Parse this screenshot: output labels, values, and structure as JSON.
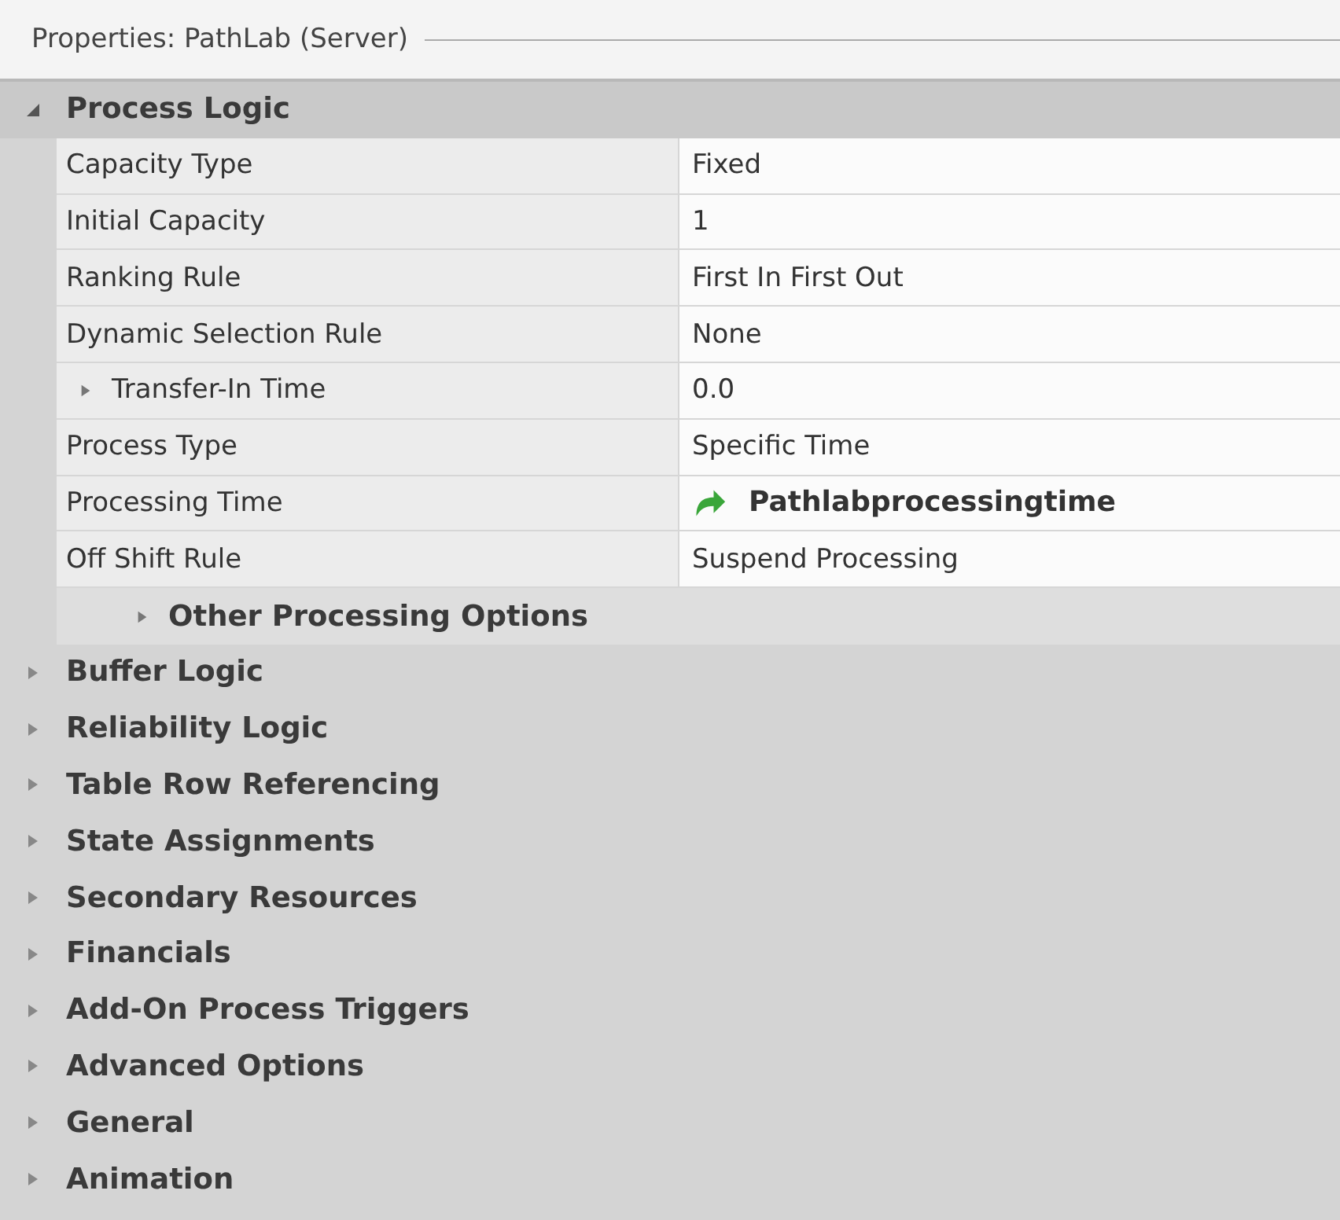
{
  "panel": {
    "title": "Properties: PathLab (Server)"
  },
  "categories": [
    {
      "label": "Process Logic",
      "expanded": true,
      "rows": [
        {
          "kind": "property",
          "name": "Capacity Type",
          "value": "Fixed"
        },
        {
          "kind": "property",
          "name": "Initial Capacity",
          "value": "1"
        },
        {
          "kind": "property",
          "name": "Ranking Rule",
          "value": "First In First Out"
        },
        {
          "kind": "property",
          "name": "Dynamic Selection Rule",
          "value": "None"
        },
        {
          "kind": "expandable",
          "name": "Transfer-In Time",
          "value": "0.0",
          "expanded": false
        },
        {
          "kind": "property",
          "name": "Process Type",
          "value": "Specific Time"
        },
        {
          "kind": "reference",
          "name": "Processing Time",
          "value": "Pathlabprocessingtime"
        },
        {
          "kind": "property",
          "name": "Off Shift Rule",
          "value": "Suspend Processing"
        },
        {
          "kind": "group",
          "name": "Other Processing Options",
          "expanded": false
        }
      ]
    },
    {
      "label": "Buffer Logic",
      "expanded": false
    },
    {
      "label": "Reliability Logic",
      "expanded": false
    },
    {
      "label": "Table Row Referencing",
      "expanded": false
    },
    {
      "label": "State Assignments",
      "expanded": false
    },
    {
      "label": "Secondary Resources",
      "expanded": false
    },
    {
      "label": "Financials",
      "expanded": false
    },
    {
      "label": "Add-On Process Triggers",
      "expanded": false
    },
    {
      "label": "Advanced Options",
      "expanded": false
    },
    {
      "label": "General",
      "expanded": false
    },
    {
      "label": "Animation",
      "expanded": false
    }
  ]
}
